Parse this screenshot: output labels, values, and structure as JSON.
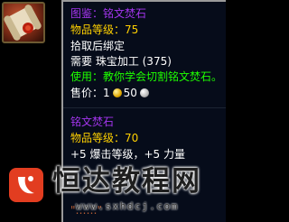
{
  "item_icon": {
    "name": "scroll-recipe-icon",
    "colors": {
      "background": "#7a2a15",
      "scroll": "#e9dcc0",
      "seal": "#b8200e"
    }
  },
  "tooltip": {
    "title": "图鉴：铭文焚石",
    "item_level": "物品等级：75",
    "binding": "拾取后绑定",
    "requirement": "需要 珠宝加工 (375)",
    "use_text": "使用：教你学会切割铭文焚石。",
    "price_label": "售价：1",
    "price_silver": "50",
    "colors": {
      "epic": "#a335ee",
      "quest": "#ffd100",
      "normal": "#ffffff",
      "green": "#1eff00",
      "background": "#060c1a"
    }
  },
  "crafted_item": {
    "name": "铭文焚石",
    "item_level": "物品等级：70",
    "stats": "+5 爆击等级，+5 力量",
    "socket_hint": "\"……\""
  },
  "watermark": {
    "title": "恒达教程网",
    "url": "www.sxhdcj.com",
    "logo_color": "#e23d20"
  }
}
